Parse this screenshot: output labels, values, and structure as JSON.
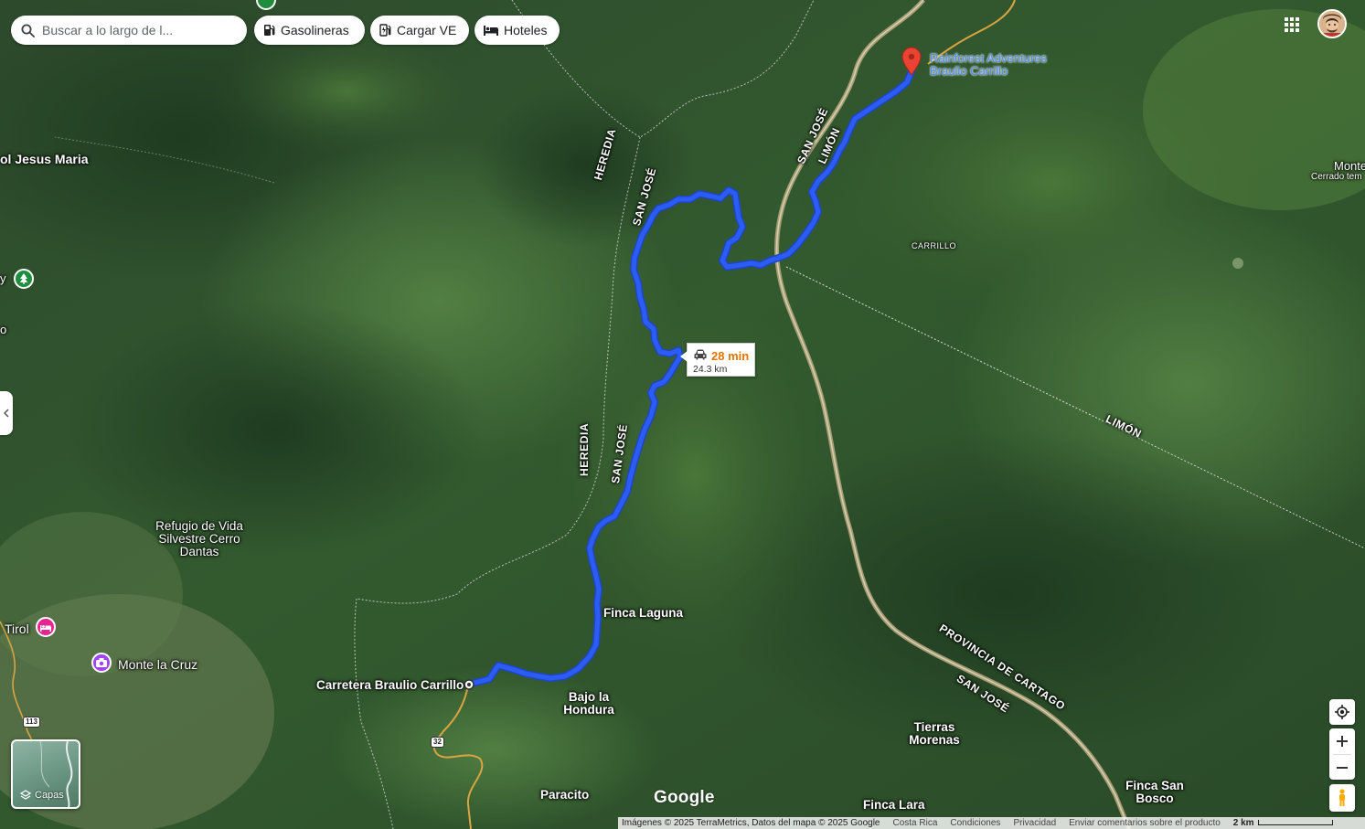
{
  "search": {
    "placeholder": "Buscar a lo largo de l..."
  },
  "chips": {
    "gas": "Gasolineras",
    "ev": "Cargar VE",
    "hotels": "Hoteles"
  },
  "route": {
    "duration": "28 min",
    "distance": "24.3 km",
    "destination_label": "Rainforest Adventures Braulio Carrillo",
    "origin_label": "Carretera Braulio Carrillo",
    "color": "#2b5cf5"
  },
  "places": {
    "jesus_maria": "ol Jesus Maria",
    "refugio": "Refugio de Vida Silvestre Cerro Dantas",
    "tirol": "Tirol",
    "monte_la_cruz": "Monte la Cruz",
    "finca_laguna": "Finca Laguna",
    "bajo_la_hondura": "Bajo la Hondura",
    "paracito": "Paracito",
    "tierras_morenas": "Tierras Morenas",
    "finca_lara": "Finca Lara",
    "finca_san_bosco": "Finca San Bosco",
    "carrillo": "CARRILLO",
    "monte_partial": "Monte",
    "cerrado_temp": "Cerrado tem",
    "left_y": "y",
    "left_o": "o"
  },
  "admin_labels": {
    "heredia_top": "HEREDIA",
    "san_jose_top": "SAN JOSÉ",
    "san_jose_right": "SAN JOSÉ",
    "limon_right": "LIMÓN",
    "heredia_mid": "HEREDIA",
    "san_jose_mid": "SAN JOSÉ",
    "limon_diag": "LIMÓN",
    "provincia_cartago": "PROVINCIA DE CARTAGO",
    "san_jose_bottom": "SAN JOSÉ"
  },
  "road_shields": {
    "r113": "113",
    "r32": "32"
  },
  "layers": {
    "label": "Capas"
  },
  "logo": "Google",
  "attribution": {
    "imagery": "Imágenes © 2025 TerraMetrics, Datos del mapa © 2025 Google",
    "country": "Costa Rica",
    "terms": "Condiciones",
    "privacy": "Privacidad",
    "feedback": "Enviar comentarios sobre el producto",
    "scale": "2 km"
  },
  "colors": {
    "route": "#2b5cf5",
    "pin": "#ea4335",
    "park_green": "#1e8e3e",
    "hotel_pink": "#e52592",
    "attraction_purple": "#a142f4"
  },
  "icons": {
    "search": "search-icon",
    "gas": "gas-station-icon",
    "ev": "ev-charger-icon",
    "hotel": "bed-icon",
    "apps": "apps-grid-icon",
    "layers": "layers-icon",
    "location": "my-location-icon",
    "pegman": "pegman-icon",
    "car": "car-icon"
  }
}
